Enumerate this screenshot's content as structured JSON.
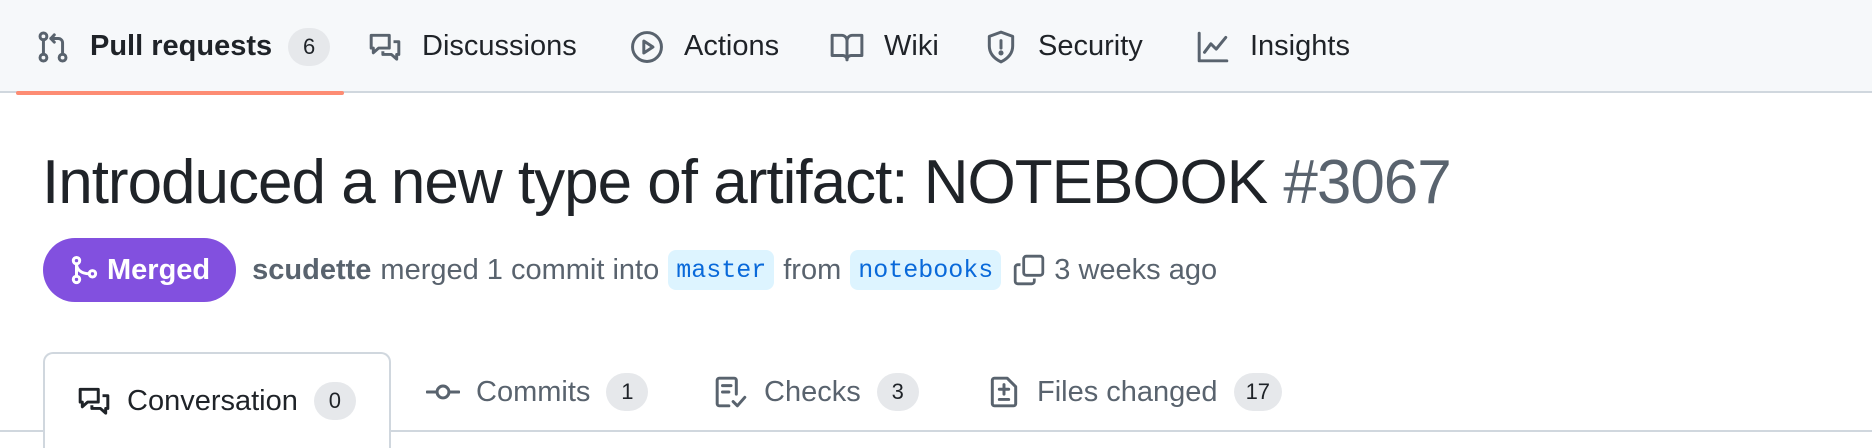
{
  "repo_nav": {
    "items": [
      {
        "label": "Pull requests",
        "icon": "git-pull-request-icon",
        "count": "6",
        "active": true
      },
      {
        "label": "Discussions",
        "icon": "comment-discussion-icon"
      },
      {
        "label": "Actions",
        "icon": "play-icon"
      },
      {
        "label": "Wiki",
        "icon": "book-icon"
      },
      {
        "label": "Security",
        "icon": "shield-icon"
      },
      {
        "label": "Insights",
        "icon": "graph-icon"
      }
    ]
  },
  "pr": {
    "title": "Introduced a new type of artifact: NOTEBOOK",
    "number": "#3067",
    "state": "Merged",
    "state_color": "#8250df",
    "author": "scudette",
    "action_text": "merged 1 commit into",
    "base_branch": "master",
    "from_text": "from",
    "head_branch": "notebooks",
    "time_ago": "3 weeks ago"
  },
  "pr_tabs": [
    {
      "label": "Conversation",
      "count": "0",
      "icon": "comment-discussion-icon",
      "active": true
    },
    {
      "label": "Commits",
      "count": "1",
      "icon": "git-commit-icon"
    },
    {
      "label": "Checks",
      "count": "3",
      "icon": "checklist-icon"
    },
    {
      "label": "Files changed",
      "count": "17",
      "icon": "file-diff-icon"
    }
  ],
  "colors": {
    "accent_underline": "#fd8c73",
    "branch_bg": "#ddf4ff",
    "branch_text": "#0969da"
  }
}
